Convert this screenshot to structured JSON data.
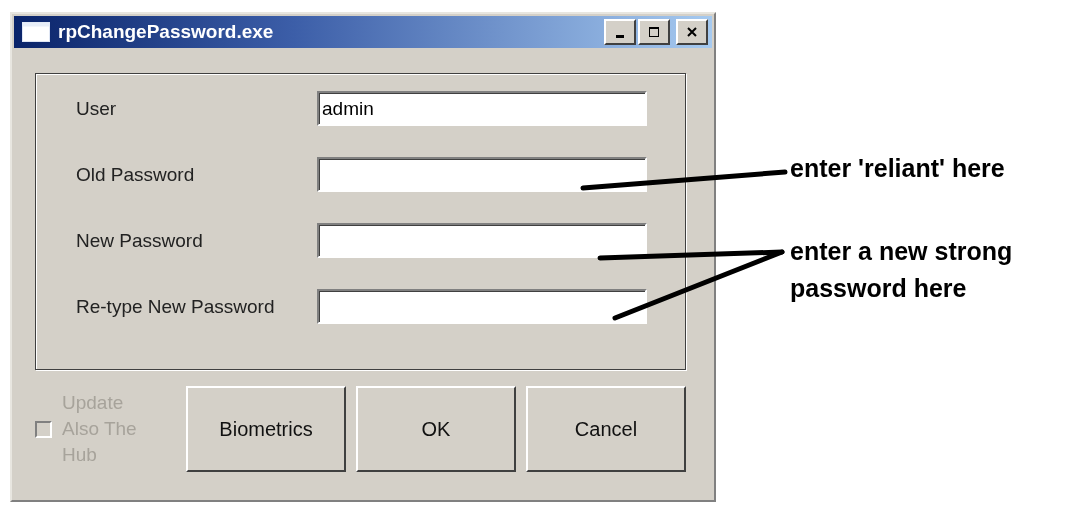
{
  "window": {
    "title": "rpChangePassword.exe"
  },
  "fields": [
    {
      "label": "User",
      "value": "admin"
    },
    {
      "label": "Old Password"
    },
    {
      "label": "New Password"
    },
    {
      "label": "Re-type New Password"
    }
  ],
  "checkbox": {
    "label": "Update Also The Hub",
    "checked": false,
    "disabled": true
  },
  "buttons": [
    "Biometrics",
    "OK",
    "Cancel"
  ],
  "annotations": [
    {
      "text": "enter 'reliant' here"
    },
    {
      "text": "enter a new strong password here"
    }
  ]
}
